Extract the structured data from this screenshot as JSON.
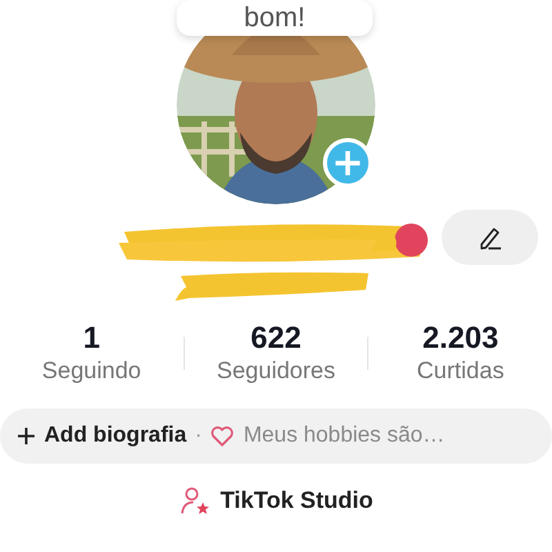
{
  "tooltip": {
    "text": "bom!"
  },
  "profile": {
    "add_button": "+"
  },
  "stats": [
    {
      "value": "1",
      "label": "Seguindo"
    },
    {
      "value": "622",
      "label": "Seguidores"
    },
    {
      "value": "2.203",
      "label": "Curtidas"
    }
  ],
  "bio": {
    "add_label": "Add biografia",
    "separator": "·",
    "suggestion": "Meus hobbies são…"
  },
  "studio": {
    "label": "TikTok Studio"
  }
}
